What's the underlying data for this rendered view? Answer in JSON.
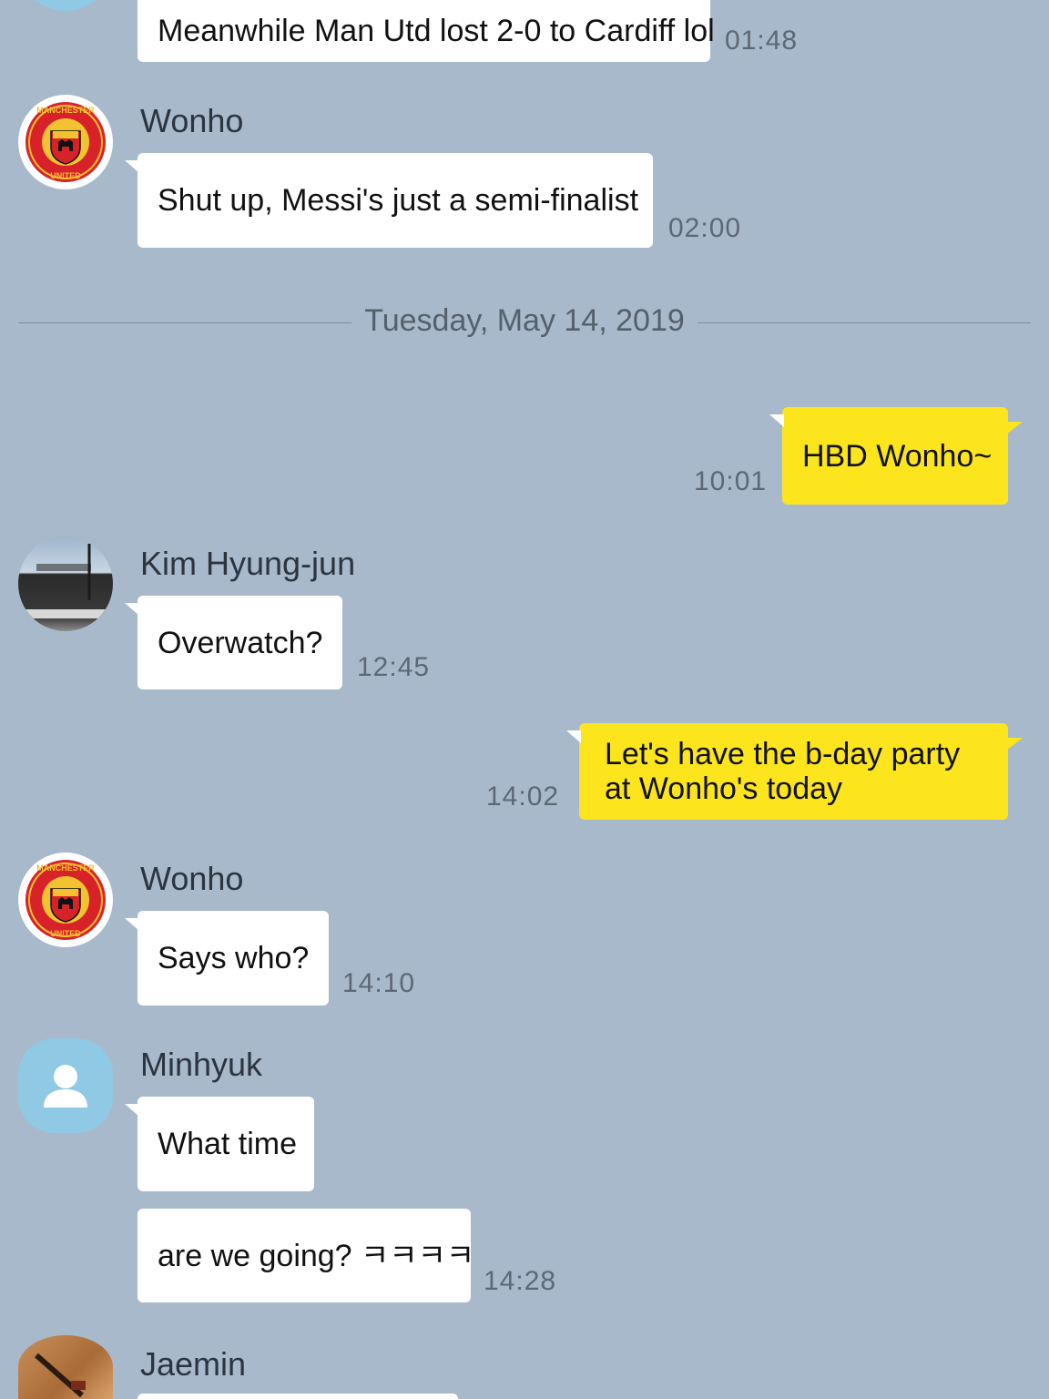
{
  "date_separator": "Tuesday, May 14, 2019",
  "senders": {
    "wonho": "Wonho",
    "kim": "Kim Hyung-jun",
    "minhyuk": "Minhyuk",
    "jaemin": "Jaemin"
  },
  "messages": [
    {
      "text": "Meanwhile Man Utd lost 2-0 to Cardiff lol",
      "time": "01:48"
    },
    {
      "text": "Shut up, Messi's just a semi-finalist",
      "time": "02:00"
    },
    {
      "text": "HBD Wonho~",
      "time": "10:01"
    },
    {
      "text": "Overwatch?",
      "time": "12:45"
    },
    {
      "line1": "Let's have the b-day party",
      "line2": "at Wonho's today",
      "time": "14:02"
    },
    {
      "text": "Says who?",
      "time": "14:10"
    },
    {
      "text": "What time"
    },
    {
      "text": "are we going? ㅋㅋㅋㅋ",
      "time": "14:28"
    }
  ],
  "logo_text": {
    "top": "MANCHESTER",
    "bottom": "UNITED"
  },
  "colors": {
    "background": "#a8b9cb",
    "my_bubble": "#fce51c",
    "their_bubble": "#ffffff"
  },
  "icons": {
    "default_avatar": "person-icon",
    "team_logo": "manchester-united-crest-icon"
  }
}
